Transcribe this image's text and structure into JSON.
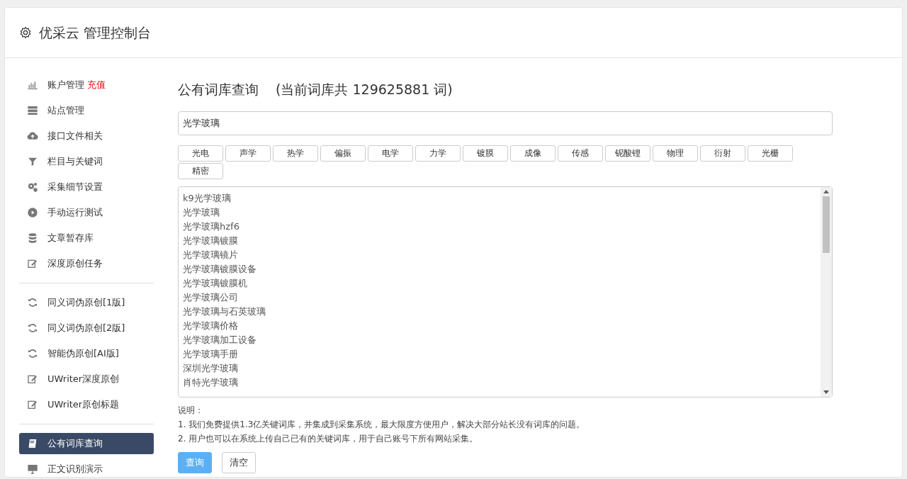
{
  "header": {
    "title": "优采云 管理控制台"
  },
  "sidebar": {
    "groups": [
      {
        "items": [
          {
            "label": "账户管理",
            "badge": "充值",
            "kind": "chart",
            "selected": false
          },
          {
            "label": "站点管理",
            "kind": "server",
            "selected": false
          },
          {
            "label": "接口文件相关",
            "kind": "cloud",
            "selected": false
          },
          {
            "label": "栏目与关键词",
            "kind": "filter",
            "selected": false
          },
          {
            "label": "采集细节设置",
            "kind": "gears",
            "selected": false
          },
          {
            "label": "手动运行测试",
            "kind": "play",
            "selected": false
          },
          {
            "label": "文章暂存库",
            "kind": "database",
            "selected": false
          },
          {
            "label": "深度原创任务",
            "kind": "edit",
            "selected": false
          }
        ]
      },
      {
        "items": [
          {
            "label": "同义词伪原创[1版]",
            "kind": "refresh",
            "selected": false
          },
          {
            "label": "同义词伪原创[2版]",
            "kind": "refresh",
            "selected": false
          },
          {
            "label": "智能伪原创[AI版]",
            "kind": "refresh",
            "selected": false
          },
          {
            "label": "UWriter深度原创",
            "kind": "edit",
            "selected": false
          },
          {
            "label": "UWriter原创标题",
            "kind": "edit",
            "selected": false
          }
        ]
      },
      {
        "items": [
          {
            "label": "公有词库查询",
            "kind": "book",
            "selected": true
          },
          {
            "label": "正文识别演示",
            "kind": "monitor",
            "selected": false
          }
        ]
      }
    ]
  },
  "main": {
    "title": "公有词库查询",
    "count_note": "(当前词库共 129625881 词)",
    "search": {
      "value": "光学玻璃"
    },
    "tags": [
      "光电",
      "声学",
      "热学",
      "偏振",
      "电学",
      "力学",
      "镀膜",
      "成像",
      "传感",
      "铌酸锂",
      "物理",
      "衍射",
      "光栅",
      "精密"
    ],
    "results": [
      "k9光学玻璃",
      "光学玻璃",
      "光学玻璃hzf6",
      "光学玻璃镀膜",
      "光学玻璃镜片",
      "光学玻璃镀膜设备",
      "光学玻璃镀膜机",
      "光学玻璃公司",
      "光学玻璃与石英玻璃",
      "光学玻璃价格",
      "光学玻璃加工设备",
      "光学玻璃手册",
      "深圳光学玻璃",
      "肖特光学玻璃"
    ],
    "notes": [
      "说明：",
      "1. 我们免费提供1.3亿关键词库，并集成到采集系统，最大限度方便用户，解决大部分站长没有词库的问题。",
      "2. 用户也可以在系统上传自己已有的关键词库，用于自己账号下所有网站采集。"
    ],
    "buttons": [
      {
        "label": "查询",
        "kind": "primary"
      },
      {
        "label": "清空",
        "kind": "default"
      }
    ]
  }
}
